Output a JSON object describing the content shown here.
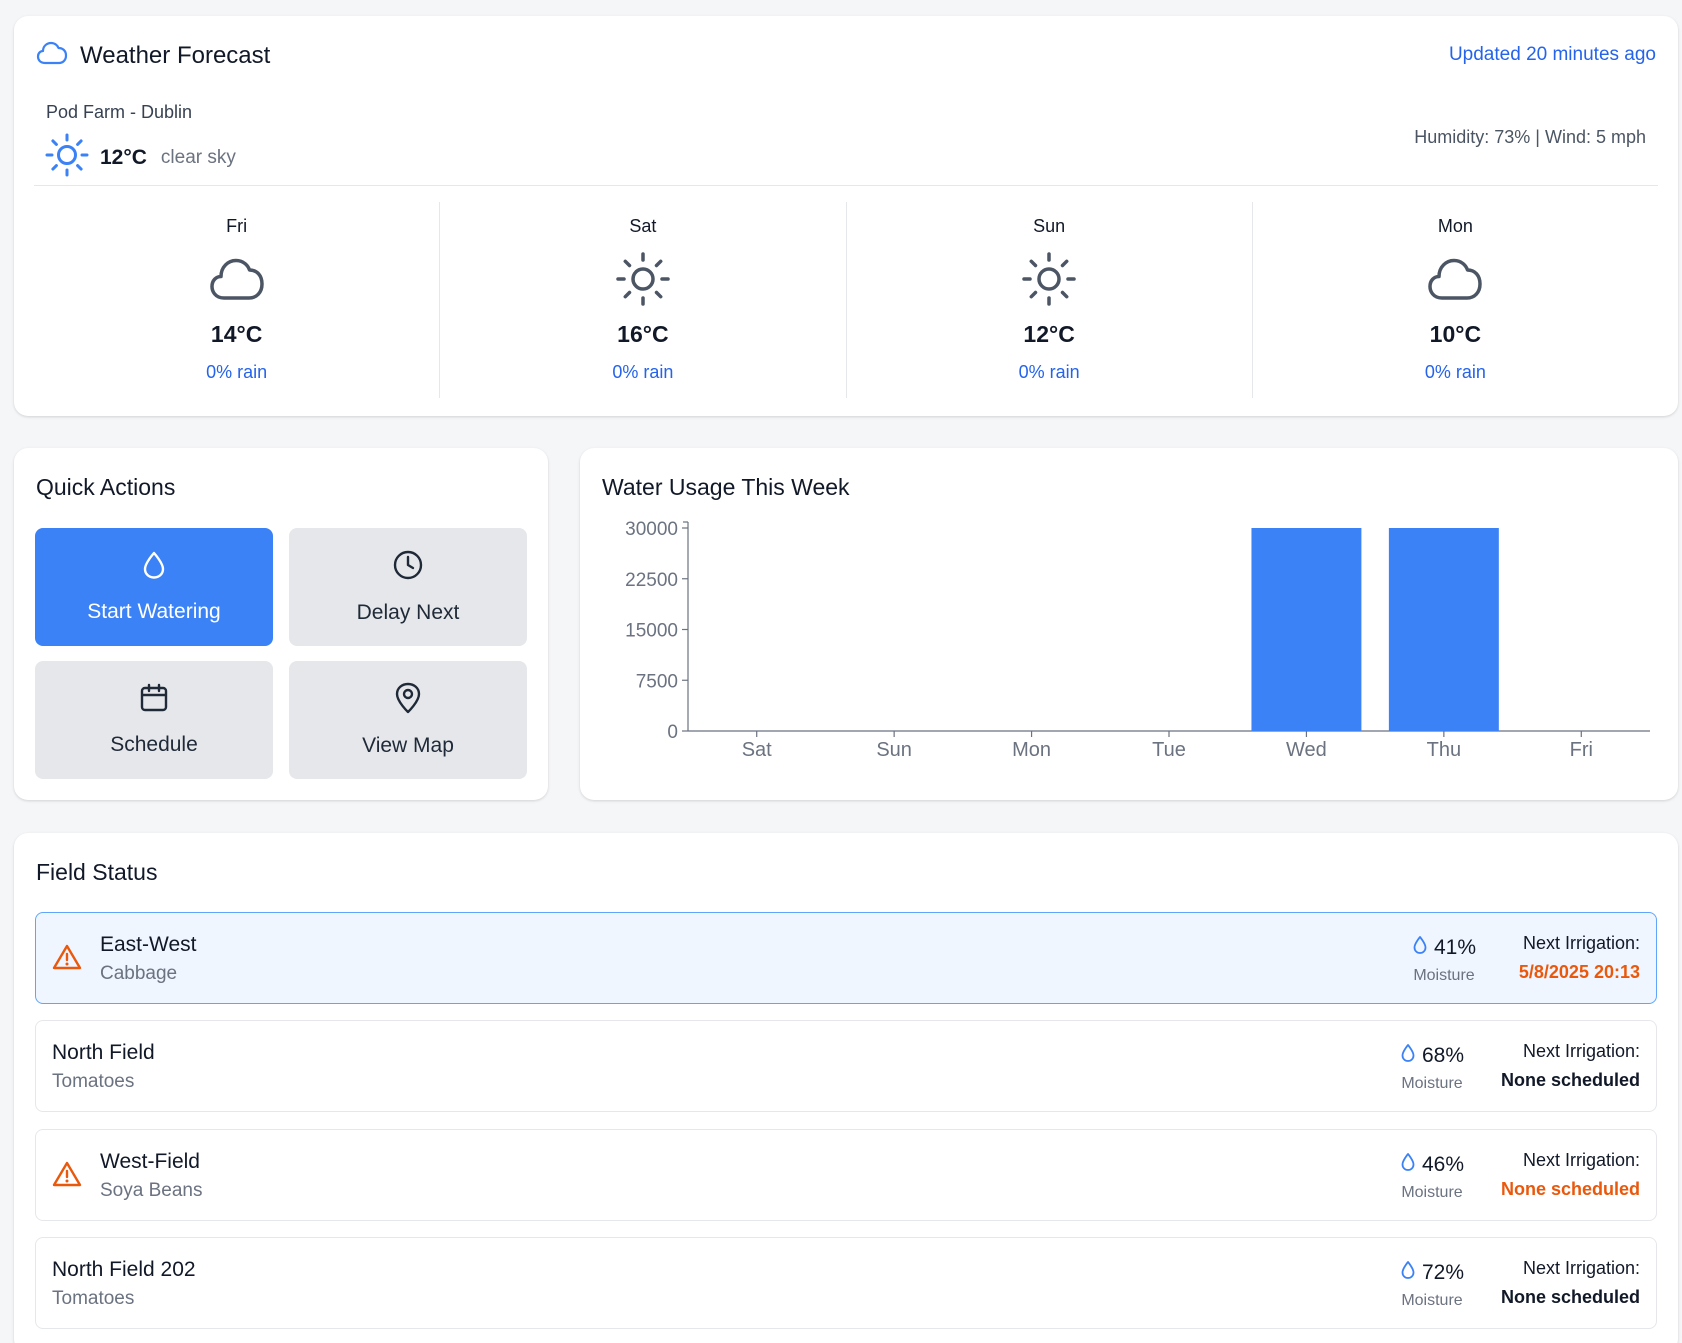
{
  "weather": {
    "title": "Weather Forecast",
    "updated": "Updated 20 minutes ago",
    "location": "Pod Farm - Dublin",
    "current_temp": "12°C",
    "current_desc": "clear sky",
    "stats": "Humidity: 73% | Wind: 5 mph",
    "forecast": [
      {
        "day": "Fri",
        "icon": "cloud-icon",
        "temp": "14°C",
        "rain": "0% rain"
      },
      {
        "day": "Sat",
        "icon": "sun-icon",
        "temp": "16°C",
        "rain": "0% rain"
      },
      {
        "day": "Sun",
        "icon": "sun-icon",
        "temp": "12°C",
        "rain": "0% rain"
      },
      {
        "day": "Mon",
        "icon": "cloud-icon",
        "temp": "10°C",
        "rain": "0% rain"
      }
    ]
  },
  "actions": {
    "title": "Quick Actions",
    "start": "Start Watering",
    "delay": "Delay Next",
    "schedule": "Schedule",
    "map": "View Map"
  },
  "chart_title": "Water Usage This Week",
  "chart_data": {
    "type": "bar",
    "categories": [
      "Sat",
      "Sun",
      "Mon",
      "Tue",
      "Wed",
      "Thu",
      "Fri"
    ],
    "values": [
      0,
      0,
      0,
      0,
      30000,
      30000,
      0
    ],
    "yticks": [
      0,
      7500,
      15000,
      22500,
      30000
    ],
    "ylim": [
      0,
      30000
    ],
    "color": "#3b82f6"
  },
  "fields": {
    "title": "Field Status",
    "moisture_label": "Moisture",
    "irrigation_label": "Next Irrigation:",
    "rows": [
      {
        "name": "East-West",
        "crop": "Cabbage",
        "moisture": "41%",
        "next": "5/8/2025 20:13",
        "alert": true,
        "highlight": true,
        "next_warn": true
      },
      {
        "name": "North Field",
        "crop": "Tomatoes",
        "moisture": "68%",
        "next": "None scheduled",
        "alert": false,
        "highlight": false,
        "next_warn": false
      },
      {
        "name": "West-Field",
        "crop": "Soya Beans",
        "moisture": "46%",
        "next": "None scheduled",
        "alert": true,
        "highlight": false,
        "next_warn": true
      },
      {
        "name": "North Field 202",
        "crop": "Tomatoes",
        "moisture": "72%",
        "next": "None scheduled",
        "alert": false,
        "highlight": false,
        "next_warn": false
      }
    ]
  },
  "colors": {
    "accent": "#3b82f6",
    "link": "#2563eb",
    "warning": "#ea580c"
  }
}
